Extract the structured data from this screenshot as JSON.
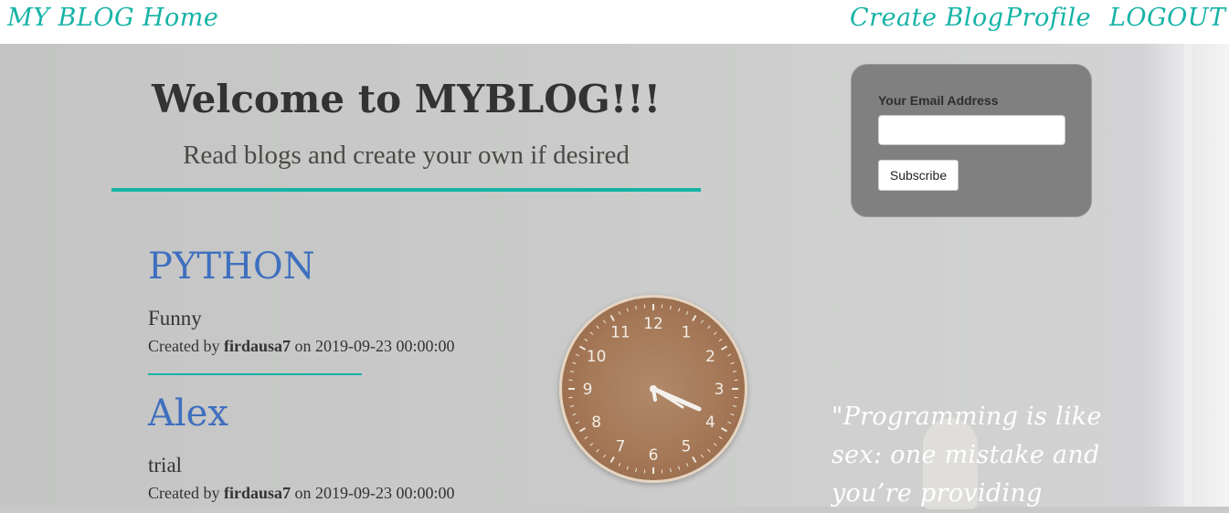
{
  "nav": {
    "brand": "MY BLOG",
    "home": "Home",
    "create_blog": "Create Blog",
    "profile": "Profile",
    "logout": "LOGOUT"
  },
  "hero": {
    "title": "Welcome to MYBLOG!!!",
    "subtitle": "Read blogs and create your own if desired"
  },
  "subscribe": {
    "label": "Your Email Address",
    "email_value": "",
    "button": "Subscribe"
  },
  "posts": [
    {
      "title": "PYTHON",
      "description": "Funny",
      "created_prefix": "Created by",
      "author": "firdausa7",
      "date_prefix": "on",
      "date": "2019-09-23 00:00:00"
    },
    {
      "title": "Alex",
      "description": "trial",
      "created_prefix": "Created by",
      "author": "firdausa7",
      "date_prefix": "on",
      "date": "2019-09-23 00:00:00"
    }
  ],
  "quote": {
    "text": "\"Programming is like sex: one mistake and you’re providing"
  },
  "clock": {
    "numbers": [
      "12",
      "1",
      "2",
      "3",
      "4",
      "5",
      "6",
      "7",
      "8",
      "9",
      "10",
      "11"
    ]
  },
  "colors": {
    "accent": "#16b3a6",
    "post_title": "#3f6fbf",
    "card_bg": "#808080"
  }
}
